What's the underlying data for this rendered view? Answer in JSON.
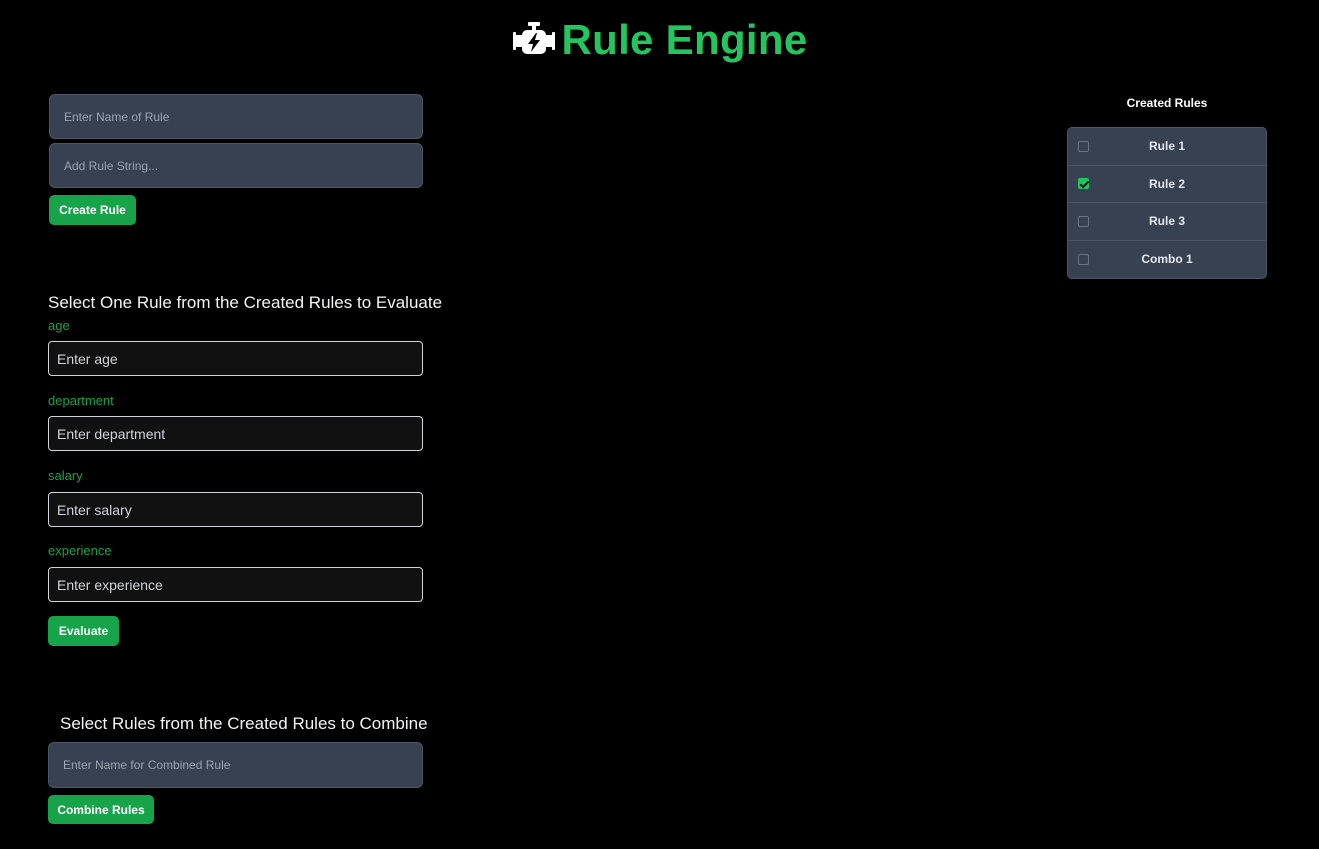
{
  "header": {
    "title": "Rule Engine",
    "icon": "engine-icon"
  },
  "create": {
    "name_placeholder": "Enter Name of Rule",
    "string_placeholder": "Add Rule String...",
    "button_label": "Create Rule"
  },
  "evaluate": {
    "heading": "Select One Rule from the Created Rules to Evaluate",
    "fields": [
      {
        "label": "age",
        "placeholder": "Enter age"
      },
      {
        "label": "department",
        "placeholder": "Enter department"
      },
      {
        "label": "salary",
        "placeholder": "Enter salary"
      },
      {
        "label": "experience",
        "placeholder": "Enter experience"
      }
    ],
    "button_label": "Evaluate"
  },
  "combine": {
    "heading": "Select Rules from the Created Rules to Combine",
    "name_placeholder": "Enter Name for Combined Rule",
    "button_label": "Combine Rules"
  },
  "rules_panel": {
    "title": "Created Rules",
    "items": [
      {
        "label": "Rule 1",
        "checked": false
      },
      {
        "label": "Rule 2",
        "checked": true
      },
      {
        "label": "Rule 3",
        "checked": false
      },
      {
        "label": "Combo 1",
        "checked": false
      }
    ]
  },
  "colors": {
    "accent": "#22c55e",
    "button": "#16a34a",
    "panel": "#374151",
    "background": "#000000"
  }
}
